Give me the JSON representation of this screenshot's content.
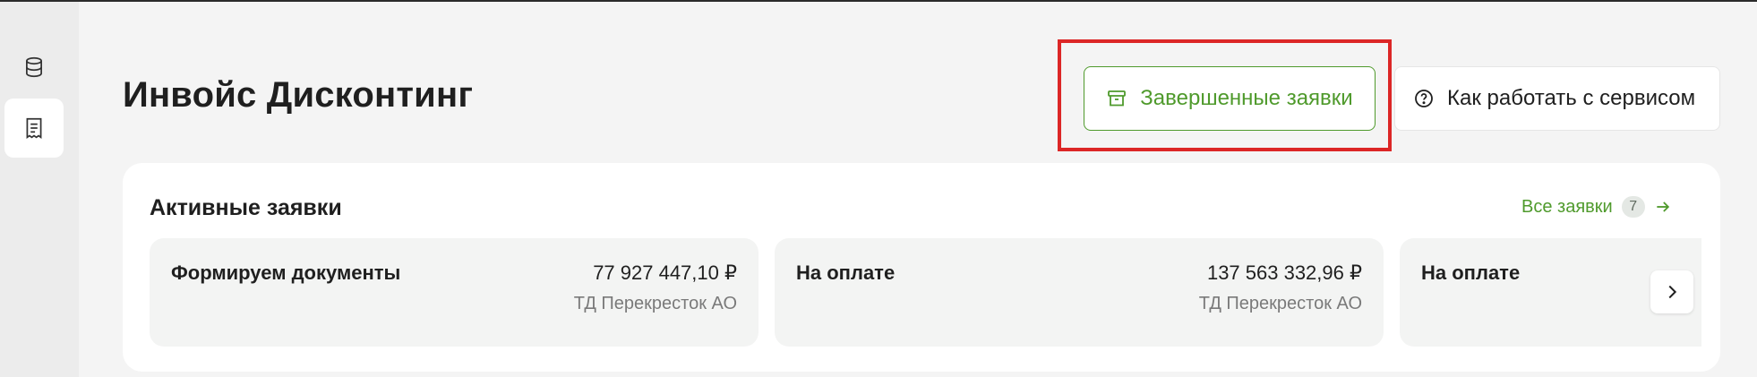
{
  "app": {
    "page_title": "Инвойс Дисконтинг"
  },
  "sidebar": {
    "items": [
      {
        "icon": "database-icon",
        "active": false
      },
      {
        "icon": "document-icon",
        "active": true
      }
    ]
  },
  "header": {
    "completed_label": "Завершенные заявки",
    "completed_icon": "archive-icon",
    "help_label": "Как работать с сервисом",
    "help_icon": "question-circle-icon"
  },
  "active_requests": {
    "title": "Активные заявки",
    "all_link_label": "Все заявки",
    "all_count": "7",
    "cards": [
      {
        "status": "Формируем документы",
        "amount": "77 927 447,10 ₽",
        "company": "ТД Перекресток АО"
      },
      {
        "status": "На оплате",
        "amount": "137 563 332,96 ₽",
        "company": "ТД Перекресток АО"
      },
      {
        "status": "На оплате",
        "amount": "",
        "company": ""
      }
    ]
  },
  "colors": {
    "accent_green": "#4f9a2c",
    "highlight_red": "#dc2626",
    "background": "#f4f4f4"
  }
}
